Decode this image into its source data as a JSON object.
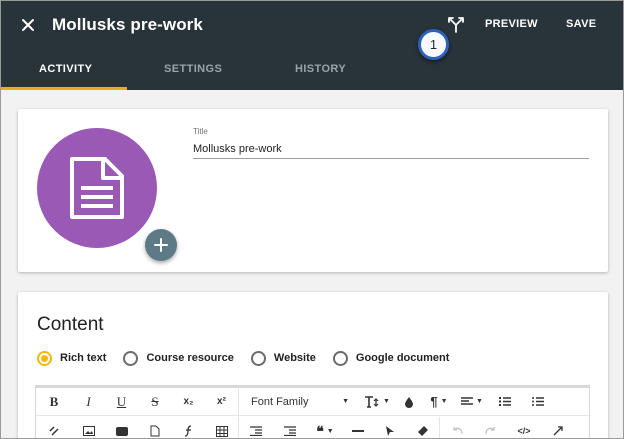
{
  "header": {
    "title": "Mollusks pre-work",
    "badge": "1",
    "preview_label": "PREVIEW",
    "save_label": "SAVE"
  },
  "tabs": [
    {
      "label": "ACTIVITY",
      "active": true
    },
    {
      "label": "SETTINGS",
      "active": false
    },
    {
      "label": "HISTORY",
      "active": false
    }
  ],
  "details": {
    "title_label": "Title",
    "title_value": "Mollusks pre-work"
  },
  "content": {
    "heading": "Content",
    "options": [
      {
        "label": "Rich text",
        "selected": true
      },
      {
        "label": "Course resource",
        "selected": false
      },
      {
        "label": "Website",
        "selected": false
      },
      {
        "label": "Google document",
        "selected": false
      }
    ],
    "toolbar": {
      "bold": "B",
      "italic": "I",
      "underline": "U",
      "strikethrough": "S",
      "subscript": "x₂",
      "superscript": "x²",
      "font_family": "Font Family"
    }
  },
  "colors": {
    "header_bg": "#29333a",
    "accent": "#f5a623",
    "avatar": "#9b59b6",
    "badge_ring": "#2d62b8"
  }
}
